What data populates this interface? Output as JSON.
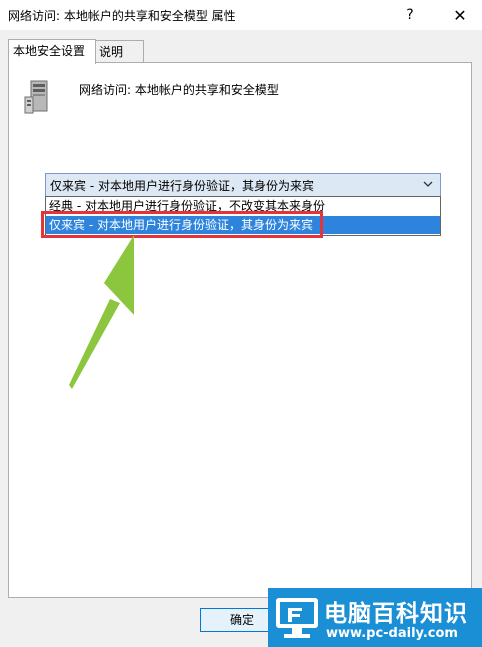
{
  "window": {
    "title": "网络访问: 本地帐户的共享和安全模型 属性",
    "help_label": "?",
    "close_label": "✕"
  },
  "tabs": [
    {
      "label": "本地安全设置"
    },
    {
      "label": "说明"
    }
  ],
  "policy": {
    "icon": "server-icon",
    "title": "网络访问: 本地帐户的共享和安全模型"
  },
  "combo": {
    "selected": "仅来宾 - 对本地用户进行身份验证，其身份为来宾",
    "options": [
      "经典 - 对本地用户进行身份验证，不改变其本来身份",
      "仅来宾 - 对本地用户进行身份验证，其身份为来宾"
    ],
    "highlighted_index": 1
  },
  "buttons": {
    "ok_label": "确定"
  },
  "watermark": {
    "main_text": "电脑百科知识",
    "url_text": "www.pc-daily.com"
  },
  "colors": {
    "highlight_border": "#e5333a",
    "arrow": "#8cc63f",
    "selection": "#2e84dd",
    "watermark_bg": "#1a8fd6"
  }
}
